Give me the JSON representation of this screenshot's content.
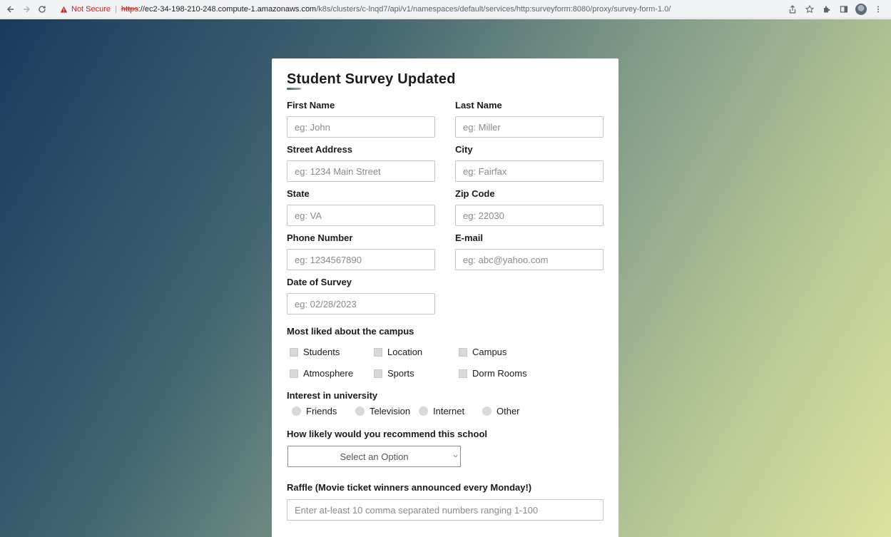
{
  "browser": {
    "security_label": "Not Secure",
    "url_scheme": "https",
    "url_host": "ec2-34-198-210-248.compute-1.amazonaws.com",
    "url_path": "/k8s/clusters/c-lnqd7/api/v1/namespaces/default/services/http:surveyform:8080/proxy/survey-form-1.0/"
  },
  "form": {
    "title": "Student Survey Updated",
    "fields": {
      "first_name": {
        "label": "First Name",
        "placeholder": "eg: John"
      },
      "last_name": {
        "label": "Last Name",
        "placeholder": "eg: Miller"
      },
      "street": {
        "label": "Street Address",
        "placeholder": "eg: 1234 Main Street"
      },
      "city": {
        "label": "City",
        "placeholder": "eg: Fairfax"
      },
      "state": {
        "label": "State",
        "placeholder": "eg: VA"
      },
      "zip": {
        "label": "Zip Code",
        "placeholder": "eg: 22030"
      },
      "phone": {
        "label": "Phone Number",
        "placeholder": "eg: 1234567890"
      },
      "email": {
        "label": "E-mail",
        "placeholder": "eg: abc@yahoo.com"
      },
      "date": {
        "label": "Date of Survey",
        "placeholder": "eg: 02/28/2023"
      }
    },
    "liked": {
      "label": "Most liked about the campus",
      "options": [
        "Students",
        "Location",
        "Campus",
        "Atmosphere",
        "Sports",
        "Dorm Rooms"
      ]
    },
    "interest": {
      "label": "Interest in university",
      "options": [
        "Friends",
        "Television",
        "Internet",
        "Other"
      ]
    },
    "recommend": {
      "label": "How likely would you recommend this school",
      "selected": "Select an Option"
    },
    "raffle": {
      "label": "Raffle (Movie ticket winners announced every Monday!)",
      "placeholder": "Enter at-least 10 comma separated numbers ranging 1-100"
    }
  },
  "colors": {
    "bg_start": "#1b3a5c",
    "bg_end": "#dde3a0",
    "accent": "#3f6170"
  }
}
